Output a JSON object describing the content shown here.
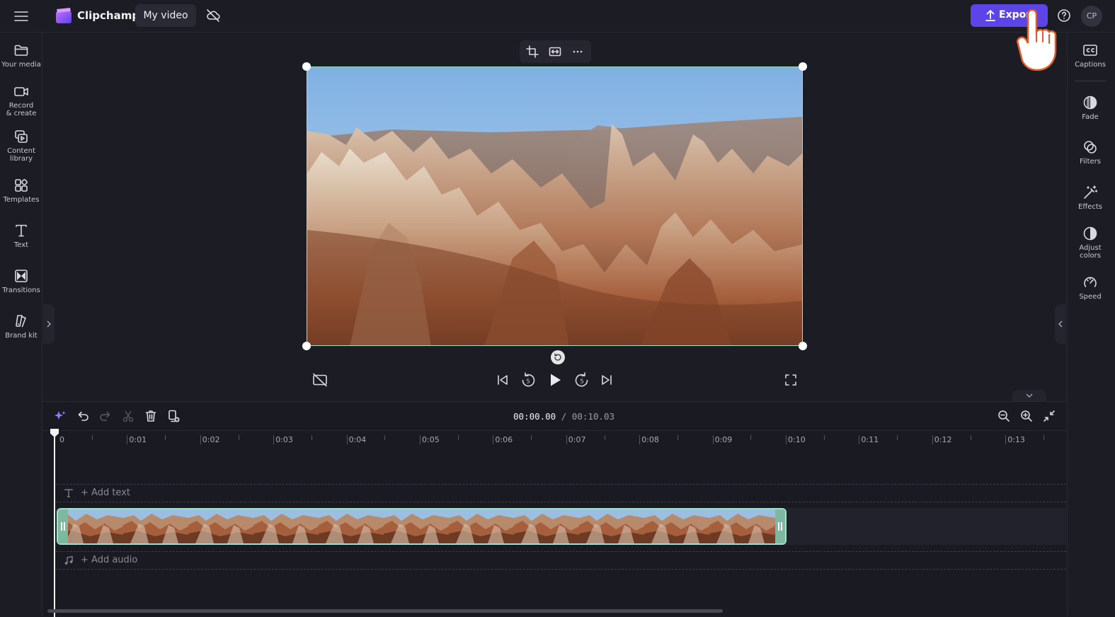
{
  "app": {
    "brand": "Clipchamp",
    "project_name": "My video",
    "export_label": "Export",
    "avatar_initials": "CP"
  },
  "left_nav": [
    {
      "label": "Your media",
      "icon": "folder-icon"
    },
    {
      "label": "Record & create",
      "icon": "camera-icon"
    },
    {
      "label": "Content library",
      "icon": "content-library-icon"
    },
    {
      "label": "Templates",
      "icon": "templates-icon"
    },
    {
      "label": "Text",
      "icon": "text-icon"
    },
    {
      "label": "Transitions",
      "icon": "transitions-icon"
    },
    {
      "label": "Brand kit",
      "icon": "brand-kit-icon"
    }
  ],
  "right_nav": [
    {
      "label": "Captions",
      "icon": "captions-icon"
    },
    {
      "label": "Fade",
      "icon": "fade-icon"
    },
    {
      "label": "Filters",
      "icon": "filters-icon"
    },
    {
      "label": "Effects",
      "icon": "effects-icon"
    },
    {
      "label": "Adjust colors",
      "icon": "adjust-colors-icon"
    },
    {
      "label": "Speed",
      "icon": "speed-icon"
    }
  ],
  "timeline": {
    "current_time": "00:00.00",
    "total_time": "/ 00:10.03",
    "ruler_labels": [
      "0",
      "0:01",
      "0:02",
      "0:03",
      "0:04",
      "0:05",
      "0:06",
      "0:07",
      "0:08",
      "0:09",
      "0:10",
      "0:11",
      "0:12",
      "0:13"
    ],
    "add_text": "+ Add text",
    "add_audio": "+ Add audio"
  },
  "colors": {
    "accent": "#5b45e8",
    "selection": "#9ee3c6",
    "background": "#1c1c25"
  }
}
